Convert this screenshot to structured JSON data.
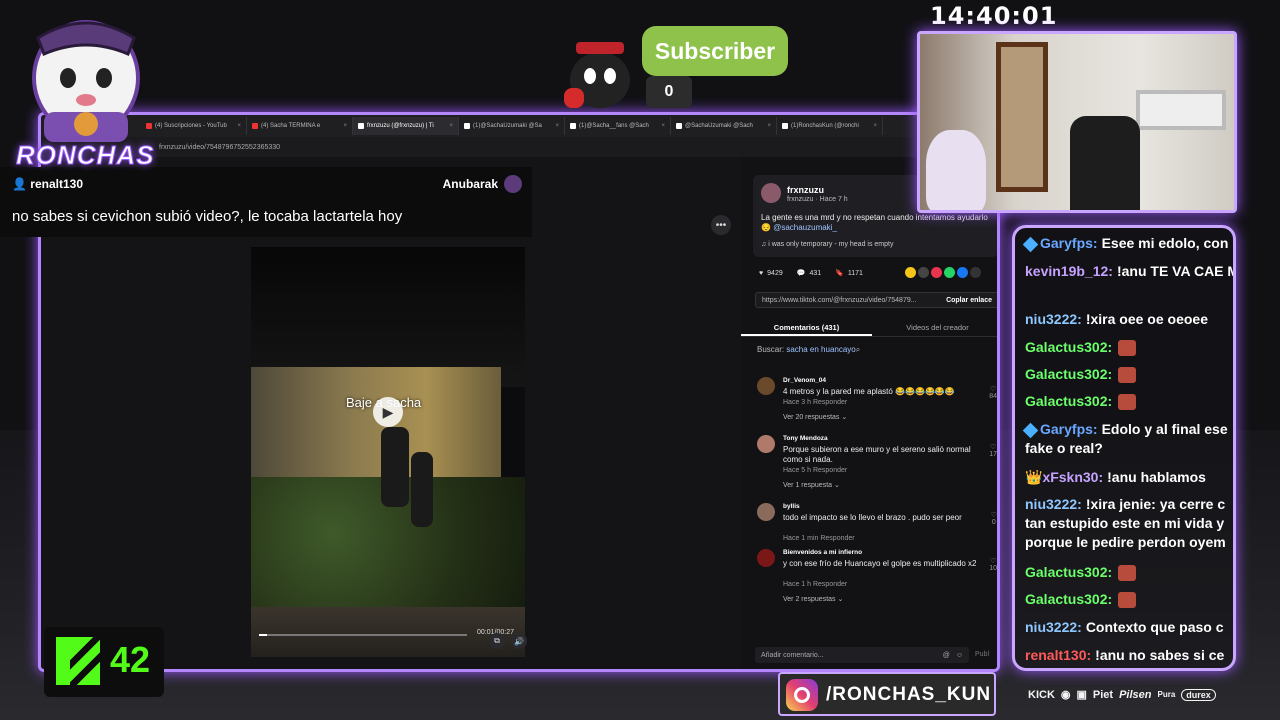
{
  "overlay": {
    "logo_text": "RONCHAS",
    "clock": "14:40:01",
    "subscriber_label": "Subscriber",
    "subscriber_count": "0",
    "kick_count": "42",
    "instagram_handle": "/RONCHAS_KUN",
    "sponsors": [
      "KICK",
      "Piet",
      "Pilsen",
      "Pura",
      "durex"
    ]
  },
  "chat_popup": {
    "username": "renalt130",
    "channel": "Anubarak",
    "message": "no sabes si cevichon subió video?, le tocaba lactartela hoy"
  },
  "browser": {
    "tabs": [
      {
        "label": "(4) Suscripciones - YouTub"
      },
      {
        "label": "(4) Sacha TERMINA e"
      },
      {
        "label": "frxnzuzu (@frxnzuzu) | Ti"
      },
      {
        "label": "(1)@SachaUzumaki @Sa"
      },
      {
        "label": "(1)@Sacha__fans @Sach"
      },
      {
        "label": "@SachaUzumaki @Sach"
      },
      {
        "label": "(1)RonchasKun (@ronchi"
      }
    ],
    "url": "frxnzuzu/video/7548796752552365330"
  },
  "video": {
    "caption": "Baje a sacha",
    "time": "00:01/00:27",
    "progress": 0.04
  },
  "post": {
    "username": "frxnzuzu",
    "subtitle": "frxnzuzu · Hace 7 h",
    "text": "La gente es una mrd y no respetan cuando intentamos ayudarlo😔",
    "mention": "@sachauzumaki_",
    "music": "i was only temporary - my head is empty",
    "likes": "9429",
    "comments": "431",
    "saves": "1171",
    "link": "https://www.tiktok.com/@frxnzuzu/video/754879...",
    "copy_label": "Coplar enlace"
  },
  "panel_tabs": [
    "Comentarios (431)",
    "Videos del creador"
  ],
  "search_hint": {
    "label": "Buscar:",
    "query": "sacha en huancayo"
  },
  "comments": [
    {
      "user": "Dr_Venom_04",
      "text": "4 metros y la pared me aplastó 😂😂😂😂😂😂",
      "meta": "Hace 3 h    Responder",
      "more": "Ver 20 respuestas ⌄",
      "likes": "84",
      "color": "#6a4a2a"
    },
    {
      "user": "Tony Mendoza",
      "text": "Porque subieron a ese muro y el sereno salió normal como si nada.",
      "meta": "Hace 5 h    Responder",
      "more": "Ver 1 respuesta ⌄",
      "likes": "17",
      "color": "#b07a6a"
    },
    {
      "user": "byllis",
      "text": "todo el impacto se lo llevo el brazo . pudo ser peor",
      "meta": "Hace 1 min    Responder",
      "more": "",
      "likes": "0",
      "color": "#8a6a5a"
    },
    {
      "user": "Bienvenidos a mi infierno",
      "text": "y con ese frío de Huancayo el golpe es multiplicado x2",
      "meta": "Hace 1 h    Responder",
      "more": "Ver 2 respuestas ⌄",
      "likes": "10",
      "color": "#7a1818"
    }
  ],
  "add_comment_placeholder": "Añadir comentario...",
  "publish_label": "Publ",
  "chat": [
    {
      "name": "Garyfps:",
      "color": "#6aa8ff",
      "badge": "diamond",
      "text": "Esee mi edolo, con",
      "emote": false
    },
    {
      "name": "kevin19b_12:",
      "color": "#c6a2ff",
      "badge": "",
      "text": "!anu TE VA CAE MIEERDA",
      "emote": false
    },
    {
      "name": "niu3222:",
      "color": "#8ec7ff",
      "badge": "",
      "text": "!xira oee oe oeoee",
      "emote": false
    },
    {
      "name": "Galactus302:",
      "color": "#6bff6b",
      "badge": "",
      "text": "",
      "emote": true
    },
    {
      "name": "Galactus302:",
      "color": "#6bff6b",
      "badge": "",
      "text": "",
      "emote": true
    },
    {
      "name": "Galactus302:",
      "color": "#6bff6b",
      "badge": "",
      "text": "",
      "emote": true
    },
    {
      "name": "Garyfps:",
      "color": "#6aa8ff",
      "badge": "diamond",
      "text": "Edolo y al final ese fake o real?",
      "emote": false
    },
    {
      "name": "xFskn30:",
      "color": "#c6a2ff",
      "badge": "crown",
      "text": "!anu hablamos",
      "emote": false
    },
    {
      "name": "niu3222:",
      "color": "#8ec7ff",
      "badge": "",
      "text": "!xira jenie: ya cerre c tan estupido este en mi vida y porque le pedire perdon oyem",
      "emote": false
    },
    {
      "name": "Galactus302:",
      "color": "#6bff6b",
      "badge": "",
      "text": "",
      "emote": true
    },
    {
      "name": "Galactus302:",
      "color": "#6bff6b",
      "badge": "",
      "text": "",
      "emote": true
    },
    {
      "name": "niu3222:",
      "color": "#8ec7ff",
      "badge": "",
      "text": "Contexto que paso c",
      "emote": false
    },
    {
      "name": "renalt130:",
      "color": "#ff5a5a",
      "badge": "",
      "text": "!anu no sabes si ce",
      "emote": false
    }
  ]
}
